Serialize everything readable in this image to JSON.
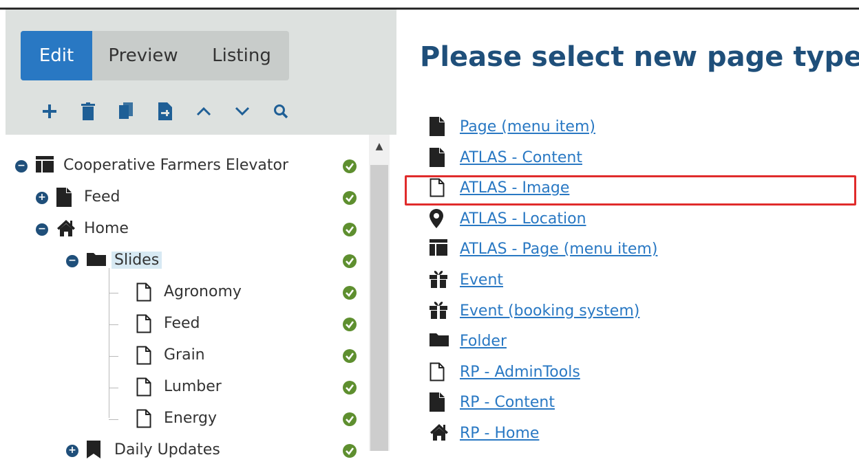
{
  "tabs": {
    "edit": "Edit",
    "preview": "Preview",
    "listing": "Listing"
  },
  "toolbar": [
    "plus-icon",
    "trash-icon",
    "copy-icon",
    "paste-icon",
    "chevron-up-icon",
    "chevron-down-icon",
    "search-icon"
  ],
  "tree": [
    {
      "label": "Cooperative Farmers Elevator",
      "icon": "layout-icon",
      "toggle": "minus"
    },
    {
      "label": "Feed",
      "icon": "document-icon",
      "toggle": "plus"
    },
    {
      "label": "Home",
      "icon": "home-icon",
      "toggle": "minus"
    },
    {
      "label": "Slides",
      "icon": "folder-icon",
      "toggle": "minus",
      "selected": true
    },
    {
      "label": "Agronomy",
      "icon": "page-outline-icon"
    },
    {
      "label": "Feed",
      "icon": "page-outline-icon"
    },
    {
      "label": "Grain",
      "icon": "page-outline-icon"
    },
    {
      "label": "Lumber",
      "icon": "page-outline-icon"
    },
    {
      "label": "Energy",
      "icon": "page-outline-icon"
    },
    {
      "label": "Daily Updates",
      "icon": "bookmark-icon",
      "toggle": "plus"
    }
  ],
  "main": {
    "title": "Please select new page type",
    "types": [
      {
        "label": "Page (menu item)",
        "icon": "document-icon"
      },
      {
        "label": "ATLAS - Content",
        "icon": "document-icon"
      },
      {
        "label": "ATLAS - Image",
        "icon": "page-outline-icon",
        "highlighted": true
      },
      {
        "label": "ATLAS - Location",
        "icon": "map-pin-icon"
      },
      {
        "label": "ATLAS - Page (menu item)",
        "icon": "layout-icon"
      },
      {
        "label": "Event",
        "icon": "gift-icon"
      },
      {
        "label": "Event (booking system)",
        "icon": "gift-icon"
      },
      {
        "label": "Folder",
        "icon": "folder-icon"
      },
      {
        "label": "RP - AdminTools",
        "icon": "page-outline-icon"
      },
      {
        "label": "RP - Content",
        "icon": "document-icon"
      },
      {
        "label": "RP - Home",
        "icon": "home-icon"
      }
    ]
  },
  "colors": {
    "accent": "#2978c3",
    "title": "#1f4f7a",
    "status_ok": "#5e8f2f",
    "highlight": "#e02b2b"
  }
}
